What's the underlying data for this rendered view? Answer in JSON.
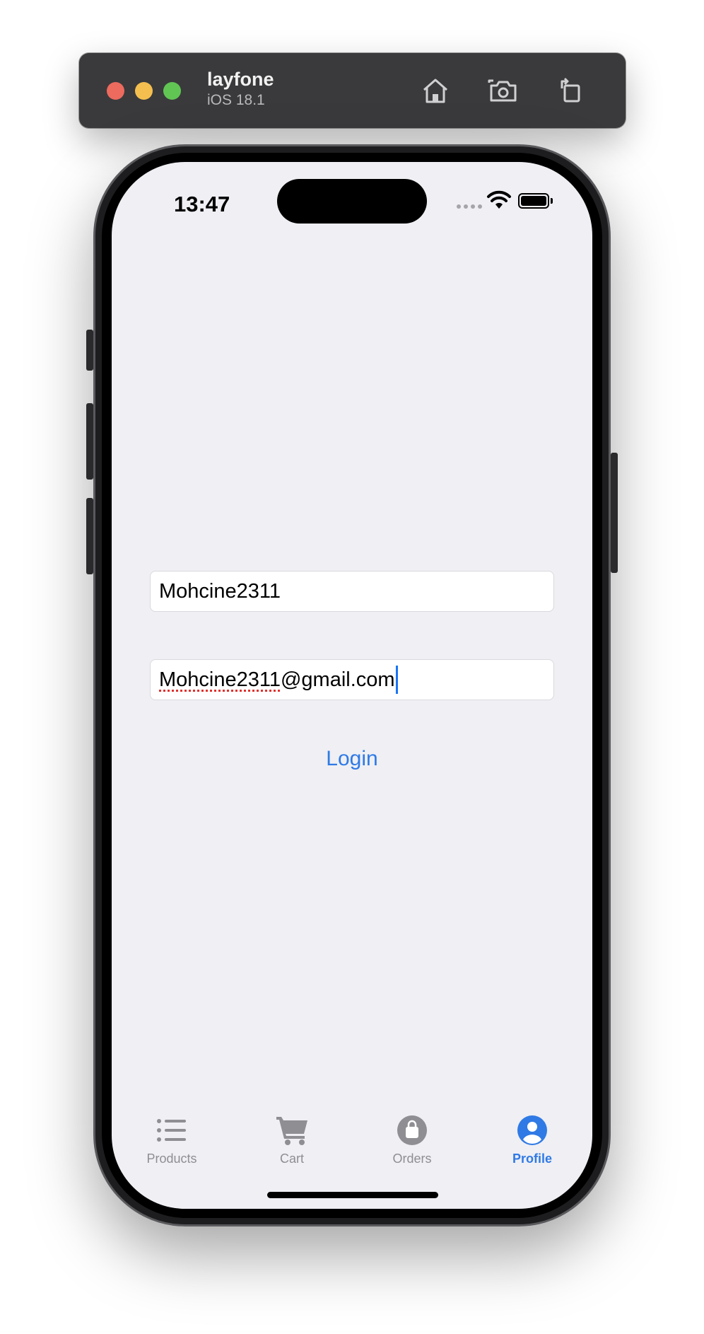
{
  "simulator": {
    "device_name": "layfone",
    "os_version": "iOS 18.1",
    "buttons": [
      {
        "icon": "home-icon"
      },
      {
        "icon": "screenshot-icon"
      },
      {
        "icon": "rotate-icon"
      }
    ]
  },
  "status_bar": {
    "time": "13:47"
  },
  "form": {
    "username_value": "Mohcine2311",
    "email_value_misspelled": "Mohcine2311",
    "email_value_rest": "@gmail.com",
    "login_label": "Login"
  },
  "tab_bar": {
    "tabs": [
      {
        "label": "Products",
        "icon": "list-icon",
        "active": false
      },
      {
        "label": "Cart",
        "icon": "cart-icon",
        "active": false
      },
      {
        "label": "Orders",
        "icon": "bag-icon",
        "active": false
      },
      {
        "label": "Profile",
        "icon": "person-icon",
        "active": true
      }
    ]
  },
  "colors": {
    "accent": "#2f7ae5",
    "inactive_tab": "#8e8e93",
    "screen_background": "#efeff4"
  }
}
